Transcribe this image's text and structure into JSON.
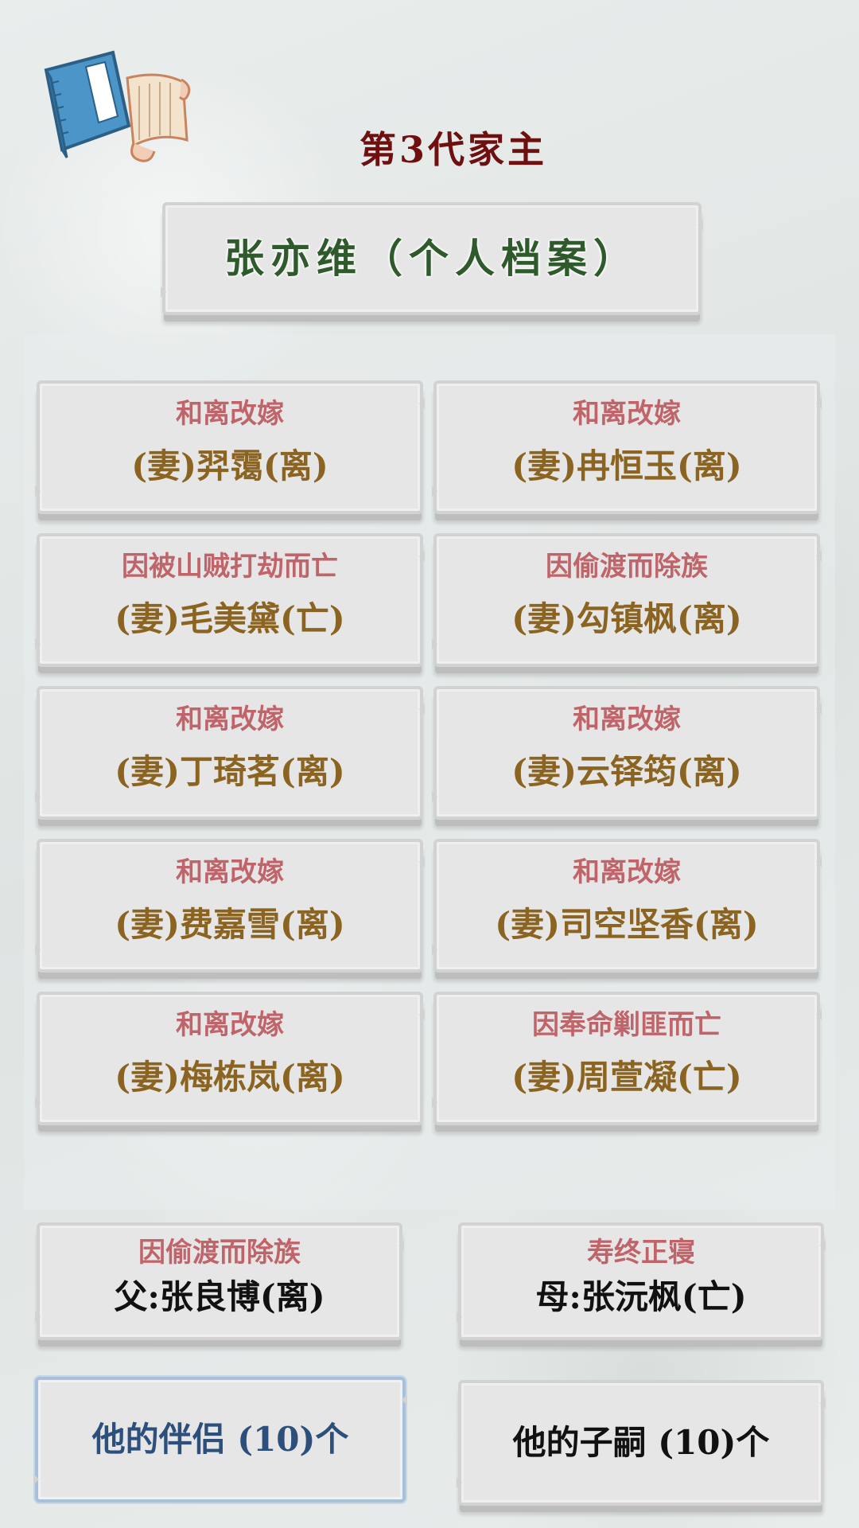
{
  "header": {
    "generation_title": "第3代家主",
    "profile_button": "张亦维（个人档案）",
    "icon": "book-scroll-icon"
  },
  "spouses": [
    {
      "cause": "和离改嫁",
      "name": "(妻)羿霭(离)"
    },
    {
      "cause": "和离改嫁",
      "name": "(妻)冉恒玉(离)"
    },
    {
      "cause": "因被山贼打劫而亡",
      "name": "(妻)毛美黛(亡)"
    },
    {
      "cause": "因偷渡而除族",
      "name": "(妻)勾镇枫(离)"
    },
    {
      "cause": "和离改嫁",
      "name": "(妻)丁琦茗(离)"
    },
    {
      "cause": "和离改嫁",
      "name": "(妻)云铎筠(离)"
    },
    {
      "cause": "和离改嫁",
      "name": "(妻)费嘉雪(离)"
    },
    {
      "cause": "和离改嫁",
      "name": "(妻)司空坚香(离)"
    },
    {
      "cause": "和离改嫁",
      "name": "(妻)梅栋岚(离)"
    },
    {
      "cause": "因奉命剿匪而亡",
      "name": "(妻)周萱凝(亡)"
    }
  ],
  "parents": {
    "father": {
      "cause": "因偷渡而除族",
      "name": "父:张良博(离)"
    },
    "mother": {
      "cause": "寿终正寝",
      "name": "母:张沅枫(亡)"
    }
  },
  "tabs": {
    "partners": "他的伴侣 (10)个",
    "children": "他的子嗣 (10)个",
    "active": "partners"
  },
  "colors": {
    "title": "#6e1010",
    "profile": "#2f5a2c",
    "cause": "#c0646a",
    "spouse_name": "#8a6420",
    "active_tab": "#2d4f7c"
  }
}
